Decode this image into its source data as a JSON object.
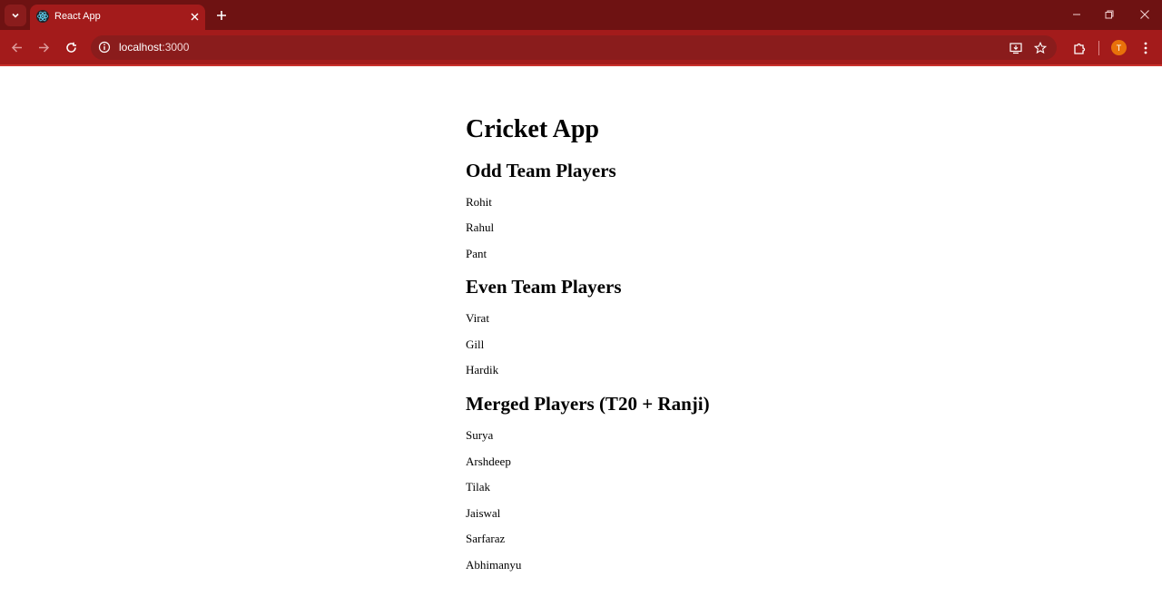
{
  "browser": {
    "tab_title": "React App",
    "url_host": "localhost",
    "url_port": ":3000",
    "profile_initial": "T"
  },
  "page": {
    "title": "Cricket App",
    "sections": [
      {
        "heading": "Odd Team Players",
        "players": [
          "Rohit",
          "Rahul",
          "Pant"
        ]
      },
      {
        "heading": "Even Team Players",
        "players": [
          "Virat",
          "Gill",
          "Hardik"
        ]
      },
      {
        "heading": "Merged Players (T20 + Ranji)",
        "players": [
          "Surya",
          "Arshdeep",
          "Tilak",
          "Jaiswal",
          "Sarfaraz",
          "Abhimanyu"
        ]
      }
    ]
  },
  "colors": {
    "tabstrip": "#6e1212",
    "toolbar": "#a31b1b",
    "omnibox": "#8a1c1c",
    "avatar": "#e8710a"
  },
  "icons": {
    "tab_search": "chevron-down-icon",
    "favicon": "react-icon",
    "tab_close": "close-icon",
    "new_tab": "plus-icon",
    "minimize": "minimize-icon",
    "restore": "restore-icon",
    "close_window": "close-icon",
    "back": "arrow-left-icon",
    "forward": "arrow-right-icon",
    "reload": "reload-icon",
    "site_info": "info-icon",
    "install": "install-icon",
    "bookmark": "star-icon",
    "extensions": "puzzle-icon",
    "menu": "kebab-menu-icon"
  }
}
